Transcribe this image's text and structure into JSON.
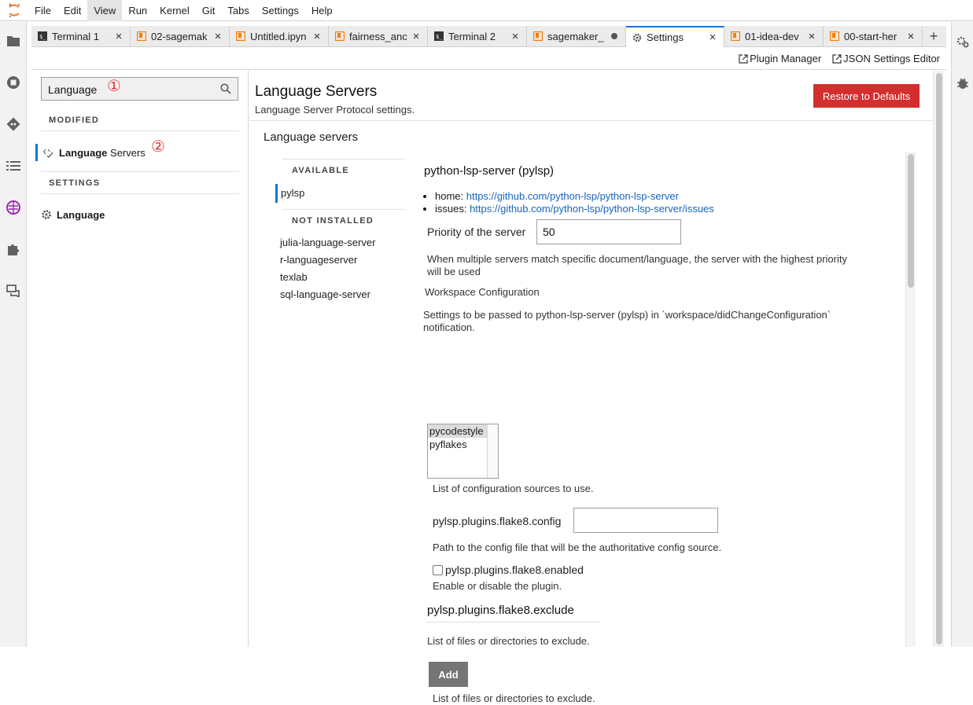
{
  "menu": [
    "File",
    "Edit",
    "View",
    "Run",
    "Kernel",
    "Git",
    "Tabs",
    "Settings",
    "Help"
  ],
  "active_menu": "View",
  "tabs": [
    {
      "label": "Terminal 1",
      "icon": "terminal-icon",
      "closer": "×"
    },
    {
      "label": "02-sagemak",
      "icon": "notebook-icon",
      "closer": "×"
    },
    {
      "label": "Untitled.ipyn",
      "icon": "notebook-icon",
      "closer": "×"
    },
    {
      "label": "fairness_anc",
      "icon": "notebook-icon",
      "closer": "×"
    },
    {
      "label": "Terminal 2",
      "icon": "terminal-icon",
      "closer": "×"
    },
    {
      "label": "sagemaker_",
      "icon": "notebook-icon",
      "closer": "dot"
    },
    {
      "label": "Settings",
      "icon": "gear-icon",
      "closer": "×"
    },
    {
      "label": "01-idea-dev",
      "icon": "notebook-icon",
      "closer": "×"
    },
    {
      "label": "00-start-her",
      "icon": "notebook-icon",
      "closer": "×"
    }
  ],
  "tab_add": "+",
  "toolbar": {
    "plugin_manager": "Plugin Manager",
    "json_editor": "JSON Settings Editor"
  },
  "search": {
    "value": "Language"
  },
  "annotations": {
    "one": "①",
    "two": "②"
  },
  "left": {
    "modified_header": "MODIFIED",
    "modified_item_bold": "Language",
    "modified_item_rest": " Servers",
    "settings_header": "SETTINGS",
    "settings_item": "Language"
  },
  "main": {
    "title": "Language Servers",
    "description": "Language Server Protocol settings.",
    "restore_button": "Restore to Defaults",
    "section_title": "Language servers"
  },
  "server_list": {
    "available_header": "AVAILABLE",
    "available": [
      "pylsp"
    ],
    "not_installed_header": "NOT INSTALLED",
    "not_installed": [
      "julia-language-server",
      "r-languageserver",
      "texlab",
      "sql-language-server"
    ]
  },
  "detail": {
    "title": "python-lsp-server (pylsp)",
    "home_label": "home: ",
    "home_url": "https://github.com/python-lsp/python-lsp-server",
    "issues_label": "issues: ",
    "issues_url": "https://github.com/python-lsp/python-lsp-server/issues",
    "priority_label": "Priority of the server",
    "priority_value": "50",
    "priority_desc_1": "When multiple servers match specific document/language, the server with the highest priority",
    "priority_desc_2": "will be used",
    "workspace_title": "Workspace Configuration",
    "workspace_desc_1": "Settings to be passed to python-lsp-server (pylsp) in `workspace/didChangeConfiguration`",
    "workspace_desc_2": "notification.",
    "config_sources": [
      "pycodestyle",
      "pyflakes"
    ],
    "config_sources_desc": "List of configuration sources to use.",
    "flake8_config_label": "pylsp.plugins.flake8.config",
    "flake8_config_value": "",
    "flake8_config_desc": "Path to the config file that will be the authoritative config source.",
    "flake8_enabled_label": "pylsp.plugins.flake8.enabled",
    "flake8_enabled_desc": "Enable or disable the plugin.",
    "exclude_title": "pylsp.plugins.flake8.exclude",
    "exclude_desc": "List of files or directories to exclude.",
    "add_button": "Add",
    "exclude_desc_2": "List of files or directories to exclude."
  },
  "colors": {
    "accent": "#1976d2",
    "danger": "#d32f2f",
    "brand": "#f37726"
  }
}
